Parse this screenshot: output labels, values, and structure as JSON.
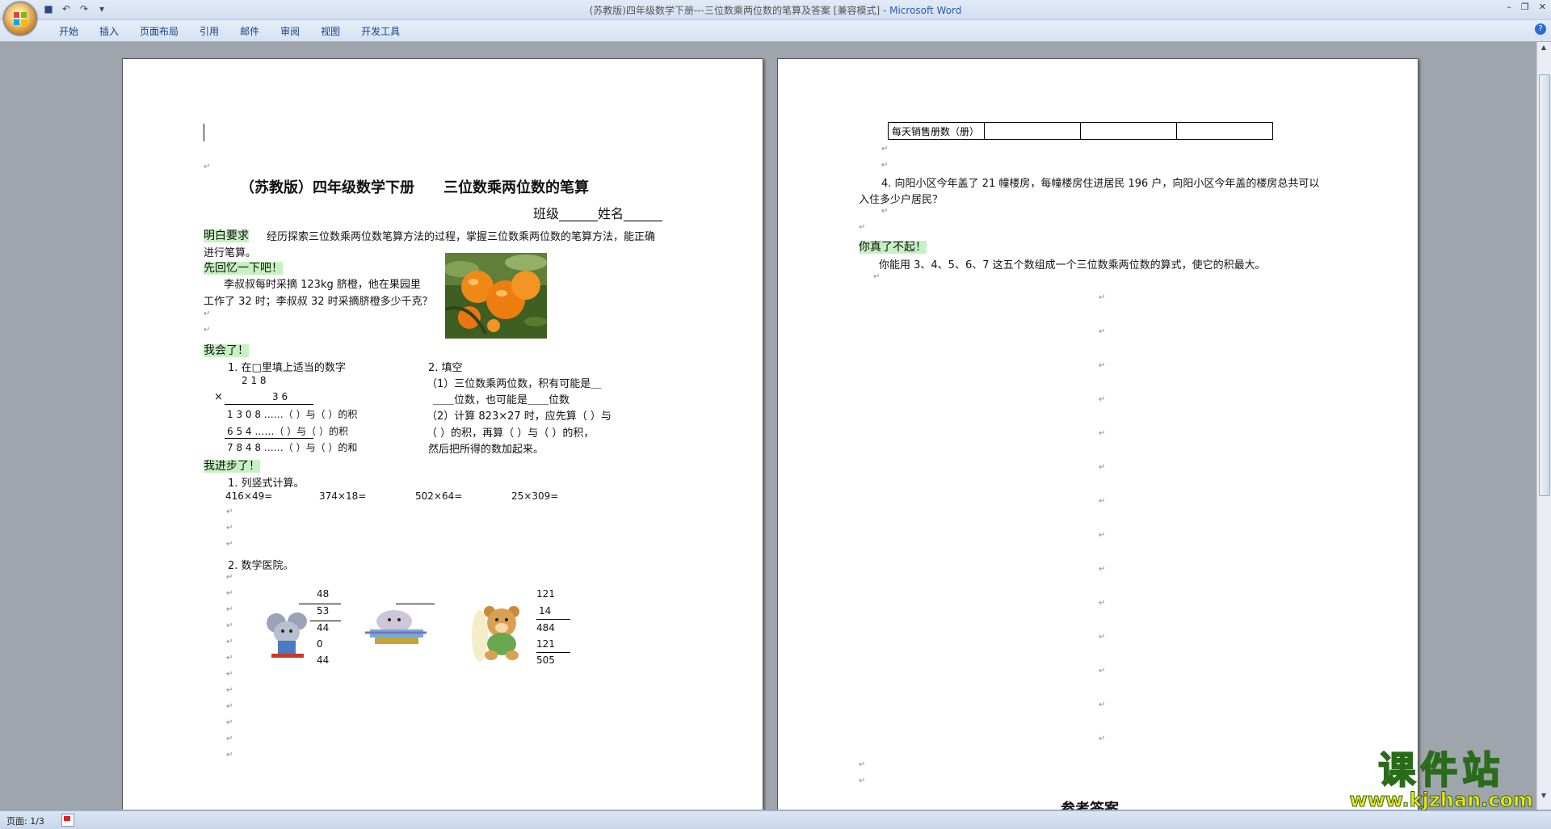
{
  "window": {
    "title_doc": "(苏教版)四年级数学下册---三位数乘两位数的笔算及答案 [兼容模式] - ",
    "title_app": "Microsoft Word"
  },
  "ribbon": {
    "tabs": [
      "开始",
      "插入",
      "页面布局",
      "引用",
      "邮件",
      "审阅",
      "视图",
      "开发工具"
    ]
  },
  "page1": {
    "heading": "（苏教版）四年级数学下册　　三位数乘两位数的笔算",
    "class_name": "班级______姓名______",
    "req_label": "明白要求",
    "req_text1": "经历探索三位数乘两位数笔算方法的过程，掌握三位数乘两位数的笔算方法，能正确",
    "req_text2": "进行笔算。",
    "recall_label": "先回忆一下吧！",
    "recall_text1": "李叔叔每时采摘 123kg 脐橙，他在果园里",
    "recall_text2": "工作了 32 时；李叔叔 32 时采摘脐橙多少千克？",
    "learned_label": "我会了！",
    "q1_title": "1.  在□里填上适当的数字",
    "q1_row1": "2   1   8",
    "q1_times": "×",
    "q1_row2": "3   6",
    "q1_row3": "1   3   0   8 ……（   ）与（   ）的积",
    "q1_row4": "6   5   4    ……（   ）与（   ）的积",
    "q1_row5": "7   8   4   8 ……（   ）与（   ）的和",
    "q2_title": "2.  填空",
    "q2_l1": "（1）三位数乘两位数，积有可能是＿",
    "q2_l2": "＿＿位数，也可能是＿＿位数",
    "q2_l3": "（2）计算 823×27 时，应先算（  ）与",
    "q2_l4": "（  ）的积，再算（  ）与（  ）的积，",
    "q2_l5": "然后把所得的数加起来。",
    "progress_label": "我进步了！",
    "calc_title": "1.  列竖式计算。",
    "calc_items": [
      "416×49=",
      "374×18=",
      "502×64=",
      "25×309="
    ],
    "hospital_title": "2.  数学医院。",
    "col1": [
      "48",
      "53",
      "44",
      "0",
      "44"
    ],
    "col3": [
      "121",
      "14",
      "484",
      "121",
      "505"
    ]
  },
  "page2": {
    "table_label": "每天销售册数（册）",
    "q4_l1": "4.  向阳小区今年盖了 21 幢楼房，每幢楼房住进居民 196 户，向阳小区今年盖的楼房总共可以",
    "q4_l2": "入住多少户居民？",
    "great_label": "你真了不起！",
    "great_text": "你能用 3、4、5、6、7 这五个数组成一个三位数乘两位数的算式，使它的积最大。",
    "answer_heading": "参考答案"
  },
  "status": {
    "page": "页面: 1/3"
  },
  "watermark": {
    "brand": "课件站",
    "url": "www.kjzhan.com"
  }
}
